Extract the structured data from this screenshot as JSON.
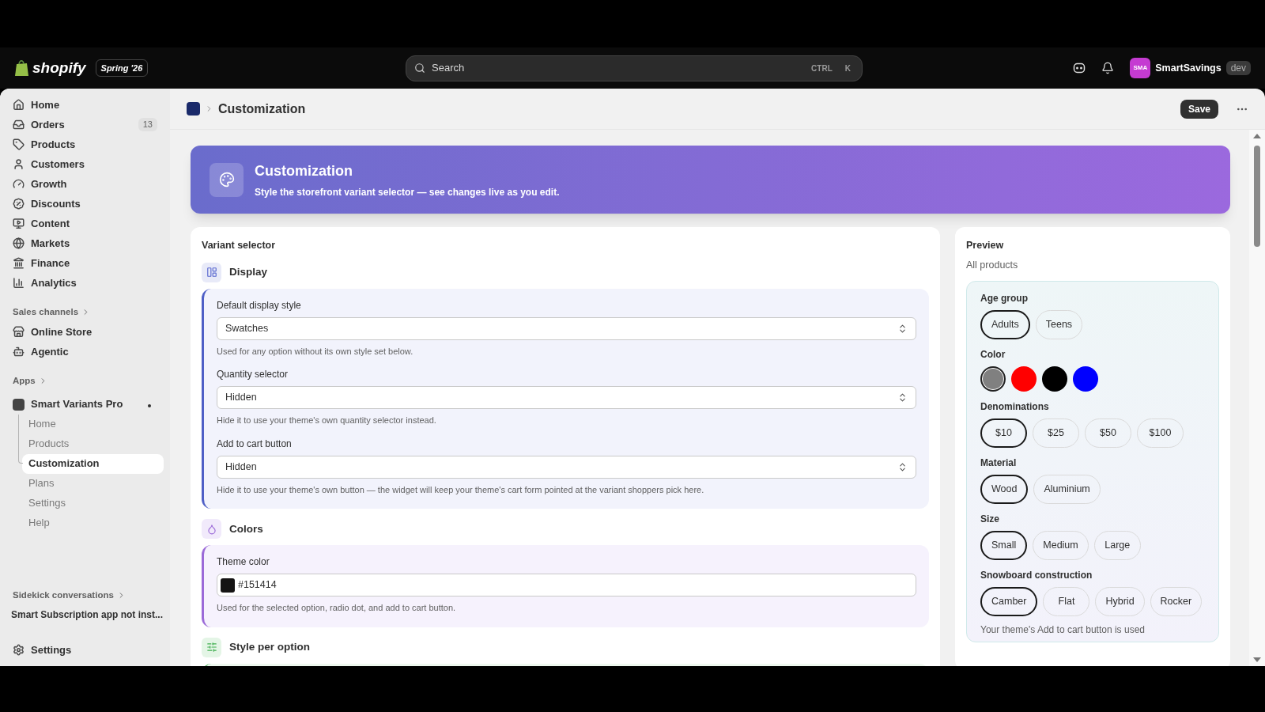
{
  "topbar": {
    "logo": "shopify",
    "badge": "Spring '26",
    "search": {
      "placeholder": "Search"
    },
    "shortcut": [
      "CTRL",
      "K"
    ],
    "store": {
      "avatar": "SMA",
      "name": "SmartSavings",
      "badge": "dev"
    }
  },
  "sidebar": {
    "items": [
      {
        "label": "Home",
        "selected": false
      },
      {
        "label": "Orders",
        "count": "13",
        "selected": false
      },
      {
        "label": "Products",
        "selected": false
      },
      {
        "label": "Customers",
        "selected": false
      },
      {
        "label": "Growth",
        "selected": false
      },
      {
        "label": "Discounts",
        "selected": false
      },
      {
        "label": "Content",
        "selected": false
      },
      {
        "label": "Markets",
        "selected": false
      },
      {
        "label": "Finance",
        "selected": false
      },
      {
        "label": "Analytics",
        "selected": false
      }
    ],
    "sales_channels": {
      "heading": "Sales channels",
      "items": [
        {
          "label": "Online Store",
          "selected": false
        },
        {
          "label": "Agentic",
          "selected": false
        }
      ]
    },
    "apps": {
      "heading": "Apps",
      "app": {
        "label": "Smart Variants Pro",
        "expanded": true,
        "children": [
          {
            "label": "Home",
            "selected": false
          },
          {
            "label": "Products",
            "selected": false
          },
          {
            "label": "Customization",
            "selected": true
          },
          {
            "label": "Plans",
            "selected": false
          },
          {
            "label": "Settings",
            "selected": false
          },
          {
            "label": "Help",
            "selected": false
          }
        ]
      }
    },
    "sidekick": {
      "heading": "Sidekick conversations",
      "items": [
        "Smart Subscription app not inst..."
      ]
    },
    "settings": "Settings"
  },
  "header": {
    "title": "Customization",
    "save": "Save"
  },
  "banner": {
    "title": "Customization",
    "subtitle": "Style the storefront variant selector — see changes live as you edit."
  },
  "settings_card": {
    "title": "Variant selector",
    "sections": [
      {
        "title": "Display",
        "kind": "display",
        "fields": [
          {
            "kind": "select",
            "label": "Default display style",
            "value": "Swatches",
            "help": "Used for any option without its own style set below."
          },
          {
            "kind": "select",
            "label": "Quantity selector",
            "value": "Hidden",
            "help": "Hide it to use your theme's own quantity selector instead."
          },
          {
            "kind": "select",
            "label": "Add to cart button",
            "value": "Hidden",
            "help": "Hide it to use your theme's own button — the widget will keep your theme's cart form pointed at the variant shoppers pick here."
          }
        ]
      },
      {
        "title": "Colors",
        "kind": "colors",
        "fields": [
          {
            "kind": "color",
            "label": "Theme color",
            "value": "#151414",
            "color": "#151414",
            "help": "Used for the selected option, radio dot, and add to cart button."
          }
        ]
      },
      {
        "title": "Style per option",
        "kind": "style"
      }
    ]
  },
  "preview": {
    "title": "Preview",
    "subtitle": "All products",
    "groups": [
      {
        "label": "Age group",
        "kind": "pills",
        "options": [
          {
            "label": "Adults",
            "selected": true
          },
          {
            "label": "Teens",
            "selected": false
          }
        ]
      },
      {
        "label": "Color",
        "kind": "swatches",
        "options": [
          {
            "color": "#808080",
            "selected": true
          },
          {
            "color": "#ff0000",
            "selected": false
          },
          {
            "color": "#000000",
            "selected": false
          },
          {
            "color": "#0000ff",
            "selected": false
          }
        ]
      },
      {
        "label": "Denominations",
        "kind": "pills",
        "options": [
          {
            "label": "$10",
            "selected": true
          },
          {
            "label": "$25",
            "selected": false
          },
          {
            "label": "$50",
            "selected": false
          },
          {
            "label": "$100",
            "selected": false
          }
        ]
      },
      {
        "label": "Material",
        "kind": "pills",
        "options": [
          {
            "label": "Wood",
            "selected": true
          },
          {
            "label": "Aluminium",
            "selected": false
          }
        ]
      },
      {
        "label": "Size",
        "kind": "pills",
        "options": [
          {
            "label": "Small",
            "selected": true
          },
          {
            "label": "Medium",
            "selected": false
          },
          {
            "label": "Large",
            "selected": false
          }
        ]
      },
      {
        "label": "Snowboard construction",
        "kind": "pills",
        "options": [
          {
            "label": "Camber",
            "selected": true
          },
          {
            "label": "Flat",
            "selected": false
          },
          {
            "label": "Hybrid",
            "selected": false
          },
          {
            "label": "Rocker",
            "selected": false
          }
        ]
      }
    ],
    "note": "Your theme's Add to cart button is used"
  }
}
